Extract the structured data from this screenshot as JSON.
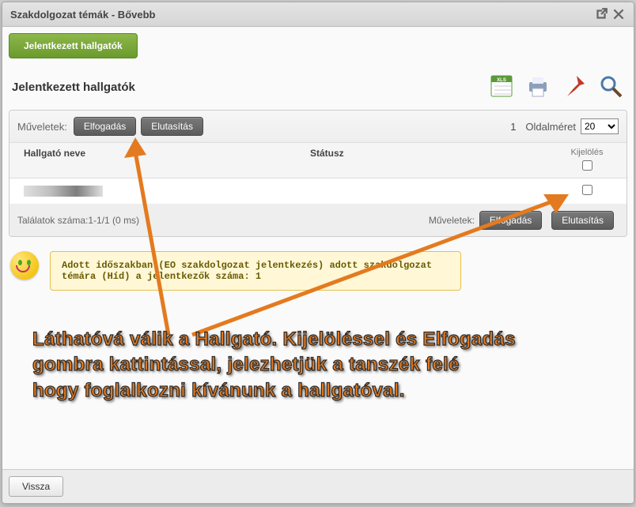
{
  "window": {
    "title": "Szakdolgozat témák - Bővebb"
  },
  "tab": {
    "label": "Jelentkezett hallgatók"
  },
  "section": {
    "title": "Jelentkezett hallgatók"
  },
  "ops": {
    "label": "Műveletek:",
    "accept": "Elfogadás",
    "reject": "Elutasítás",
    "page_num": "1",
    "page_size_label": "Oldalméret",
    "page_size_value": "20"
  },
  "table": {
    "head_name": "Hallgató neve",
    "head_status": "Státusz",
    "head_sel": "Kijelölés",
    "rows": [
      {
        "name": "",
        "status": ""
      }
    ],
    "foot_left": "Találatok száma:1-1/1 (0 ms)",
    "foot_ops_label": "Műveletek:",
    "foot_accept": "Elfogadás",
    "foot_reject": "Elutasítás"
  },
  "note": {
    "text": "Adott időszakban (EO szakdolgozat jelentkezés) adott szakdolgozat témára (Híd) a jelentkezők száma: 1"
  },
  "annotation": {
    "line1": "Láthatóvá válik a Hallgató. Kijelöléssel és Elfogadás",
    "line2": "gombra kattintással, jelezhetjük a tanszék felé",
    "line3": "hogy foglalkozni kívánunk a hallgatóval."
  },
  "footer": {
    "back": "Vissza"
  },
  "icons": {
    "xls": "xls-icon",
    "print": "print-icon",
    "pin": "pin-icon",
    "search": "search-icon"
  }
}
